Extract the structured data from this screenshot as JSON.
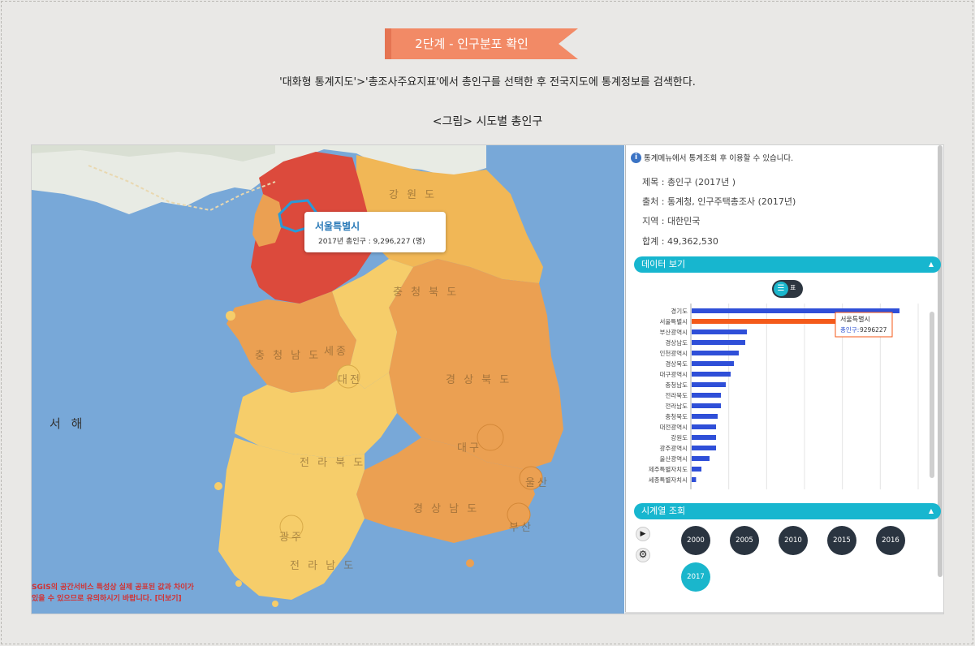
{
  "banner": {
    "step_label": "2단계 - 인구분포 확인"
  },
  "description": "'대화형 통계지도'>'총조사주요지표'에서 총인구를 선택한 후 전국지도에 통계정보를 검색한다.",
  "figure_caption": "<그림> 시도별 총인구",
  "map": {
    "sea_label": "서 해",
    "tooltip": {
      "region": "서울특별시",
      "detail": "2017년 총인구 : 9,296,227 (명)"
    },
    "notice": [
      "SGIS의 공간서비스 특성상 실제 공표된 값과 차이가",
      "있을 수 있으므로 유의하시기 바랍니다. [더보기]"
    ],
    "region_labels": [
      "강 원 도",
      "충 청 북 도",
      "충 청 남 도",
      "경 상 북 도",
      "전 라 북 도",
      "경 상 남 도",
      "전 라 남 도",
      "대구",
      "울산",
      "부산",
      "광주",
      "대전",
      "세종"
    ],
    "colors": {
      "sea": "#78a8d8",
      "very_high": "#dc4a3c",
      "high": "#eba052",
      "mid": "#f1b756",
      "low": "#f6cd6a",
      "boundary": "#2a9ad8"
    }
  },
  "side": {
    "info": "통계메뉴에서 통계조회 후 이용할 수 있습니다.",
    "info_icon": "info-icon",
    "meta": [
      "제목 : 총인구 (2017년 )",
      "출처 : 통계청, 인구주택총조사 (2017년)",
      "지역 : 대한민국",
      "합계 : 49,362,530"
    ],
    "data_section": "데이터 보기",
    "toggle_label": "표",
    "timeline_section": "시계열 조회",
    "years": [
      "2000",
      "2005",
      "2010",
      "2015",
      "2016",
      "2017"
    ],
    "active_year": "2017",
    "chart_tooltip": {
      "title": "서울특별시",
      "label": "총인구:",
      "value": "9296227"
    }
  },
  "chart_data": {
    "type": "bar",
    "orientation": "horizontal",
    "categories": [
      "경기도",
      "서울특별시",
      "부산광역시",
      "경상남도",
      "인천광역시",
      "경상북도",
      "대구광역시",
      "충청남도",
      "전라북도",
      "전라남도",
      "충청북도",
      "대전광역시",
      "강원도",
      "광주광역시",
      "울산광역시",
      "제주특별자치도",
      "세종특별자치시"
    ],
    "values": [
      12800000,
      9296227,
      3400000,
      3300000,
      2900000,
      2600000,
      2400000,
      2100000,
      1800000,
      1800000,
      1600000,
      1500000,
      1500000,
      1500000,
      1100000,
      600000,
      270000
    ],
    "highlight": "서울특별시",
    "colors": {
      "default": "#2f4fd8",
      "highlight": "#f45a1a"
    },
    "xlim": [
      0,
      14000000
    ],
    "grid": true
  }
}
